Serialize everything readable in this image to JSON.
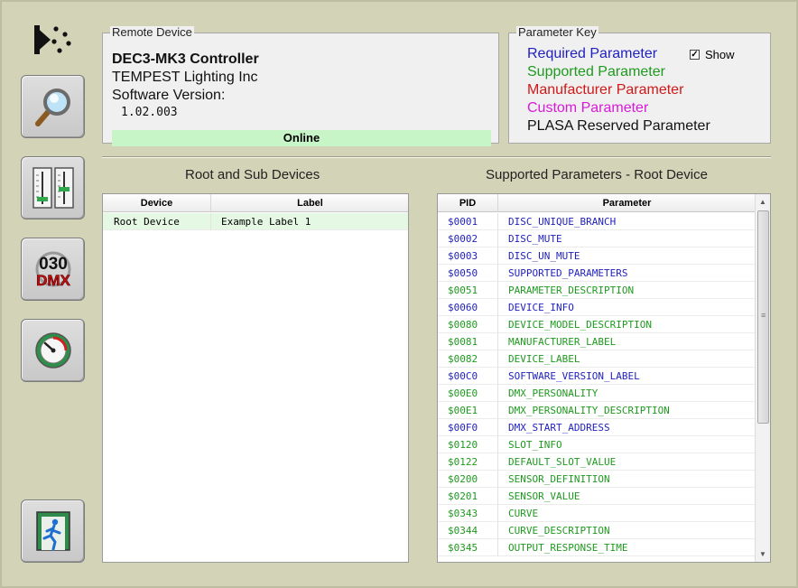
{
  "remote_device": {
    "title": "Remote Device",
    "model": "DEC3-MK3 Controller",
    "manufacturer": "TEMPEST Lighting Inc",
    "software_label": "Software Version:",
    "software_version": "1.02.003",
    "status": "Online"
  },
  "parameter_key": {
    "title": "Parameter Key",
    "show_label": "Show",
    "show_checked": true,
    "items": [
      {
        "label": "Required Parameter",
        "color": "#1f1fbf"
      },
      {
        "label": "Supported Parameter",
        "color": "#1f9a1f"
      },
      {
        "label": "Manufacturer Parameter",
        "color": "#d01818"
      },
      {
        "label": "Custom Parameter",
        "color": "#d81ad8"
      },
      {
        "label": "PLASA Reserved Parameter",
        "color": "#111111"
      }
    ]
  },
  "sidebar": {
    "buttons": [
      {
        "name": "search-devices-button",
        "icon": "magnifier-icon"
      },
      {
        "name": "dmx-faders-button",
        "icon": "faders-icon"
      },
      {
        "name": "dmx-address-button",
        "icon": "dmx-address-icon",
        "text_top": "030",
        "text_bottom": "DMX"
      },
      {
        "name": "gauge-button",
        "icon": "gauge-icon"
      },
      {
        "name": "exit-button",
        "icon": "exit-icon"
      }
    ]
  },
  "devices_section": {
    "title": "Root and Sub Devices",
    "columns": [
      "Device",
      "Label"
    ],
    "rows": [
      {
        "device": "Root Device",
        "label": "Example Label 1"
      }
    ]
  },
  "params_section": {
    "title": "Supported Parameters - Root Device",
    "columns": [
      "PID",
      "Parameter"
    ],
    "rows": [
      {
        "pid": "$0001",
        "name": "DISC_UNIQUE_BRANCH",
        "kind": "required"
      },
      {
        "pid": "$0002",
        "name": "DISC_MUTE",
        "kind": "required"
      },
      {
        "pid": "$0003",
        "name": "DISC_UN_MUTE",
        "kind": "required"
      },
      {
        "pid": "$0050",
        "name": "SUPPORTED_PARAMETERS",
        "kind": "required"
      },
      {
        "pid": "$0051",
        "name": "PARAMETER_DESCRIPTION",
        "kind": "supported"
      },
      {
        "pid": "$0060",
        "name": "DEVICE_INFO",
        "kind": "required"
      },
      {
        "pid": "$0080",
        "name": "DEVICE_MODEL_DESCRIPTION",
        "kind": "supported"
      },
      {
        "pid": "$0081",
        "name": "MANUFACTURER_LABEL",
        "kind": "supported"
      },
      {
        "pid": "$0082",
        "name": "DEVICE_LABEL",
        "kind": "supported"
      },
      {
        "pid": "$00C0",
        "name": "SOFTWARE_VERSION_LABEL",
        "kind": "required"
      },
      {
        "pid": "$00E0",
        "name": "DMX_PERSONALITY",
        "kind": "supported"
      },
      {
        "pid": "$00E1",
        "name": "DMX_PERSONALITY_DESCRIPTION",
        "kind": "supported"
      },
      {
        "pid": "$00F0",
        "name": "DMX_START_ADDRESS",
        "kind": "required"
      },
      {
        "pid": "$0120",
        "name": "SLOT_INFO",
        "kind": "supported"
      },
      {
        "pid": "$0122",
        "name": "DEFAULT_SLOT_VALUE",
        "kind": "supported"
      },
      {
        "pid": "$0200",
        "name": "SENSOR_DEFINITION",
        "kind": "supported"
      },
      {
        "pid": "$0201",
        "name": "SENSOR_VALUE",
        "kind": "supported"
      },
      {
        "pid": "$0343",
        "name": "CURVE",
        "kind": "supported"
      },
      {
        "pid": "$0344",
        "name": "CURVE_DESCRIPTION",
        "kind": "supported"
      },
      {
        "pid": "$0345",
        "name": "OUTPUT_RESPONSE_TIME",
        "kind": "supported"
      }
    ],
    "colors": {
      "required": "#1f1fbf",
      "supported": "#1f9a1f"
    }
  },
  "colors": {
    "online_bg": "#c8f5c8",
    "selected_row_bg": "#e4f8e4"
  }
}
